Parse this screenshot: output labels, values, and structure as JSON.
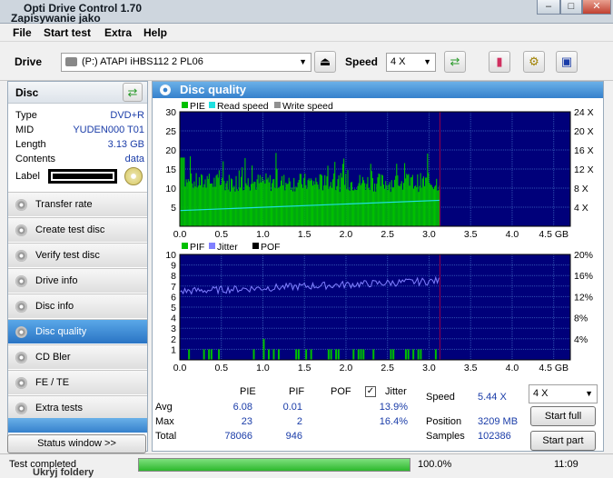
{
  "window": {
    "title": "Opti Drive Control 1.70",
    "behind_title": "Zapisywanie jako",
    "behind_footer": "Ukryj foldery"
  },
  "menu": [
    "File",
    "Start test",
    "Extra",
    "Help"
  ],
  "toolbar": {
    "drive_label": "Drive",
    "drive_value": "(P:)  ATAPI iHBS112  2 PL06",
    "speed_label": "Speed",
    "speed_value": "4 X"
  },
  "disc": {
    "header": "Disc",
    "rows": [
      {
        "label": "Type",
        "value": "DVD+R"
      },
      {
        "label": "MID",
        "value": "YUDEN000 T01"
      },
      {
        "label": "Length",
        "value": "3.13 GB"
      },
      {
        "label": "Contents",
        "value": "data"
      }
    ],
    "label_label": "Label"
  },
  "nav": [
    "Transfer rate",
    "Create test disc",
    "Verify test disc",
    "Drive info",
    "Disc info",
    "Disc quality",
    "CD Bler",
    "FE / TE",
    "Extra tests"
  ],
  "nav_active": 5,
  "status_window": "Status window >>",
  "panel_title": "Disc quality",
  "legend1": [
    "PIE",
    "Read speed",
    "Write speed"
  ],
  "legend2": [
    "PIF",
    "Jitter",
    "POF"
  ],
  "colors": {
    "pie": "#00c000",
    "read": "#20e0e0",
    "write": "#909090",
    "pif": "#00c000",
    "jitter": "#8080ff",
    "pof": "#000000",
    "plot_bg": "#00007a",
    "grid": "#3050b0",
    "marker": "#a00040"
  },
  "chart_data": [
    {
      "type": "area",
      "series": [
        {
          "name": "PIE",
          "stat_max": 23,
          "stat_avg": 6.08
        },
        {
          "name": "Read speed",
          "unit": "X"
        }
      ],
      "x_ticks": [
        "0.0",
        "0.5",
        "1.0",
        "1.5",
        "2.0",
        "2.5",
        "3.0",
        "3.5",
        "4.0",
        "4.5 GB"
      ],
      "y_ticks_left": [
        "30",
        "25",
        "20",
        "15",
        "10",
        "5"
      ],
      "y_ticks_right": [
        "24 X",
        "20 X",
        "16 X",
        "12 X",
        "8 X",
        "4 X"
      ],
      "xlim": [
        0,
        4.7
      ],
      "ylim_left": [
        0,
        30
      ],
      "data_end_gb": 3.13,
      "read_speed": [
        [
          0.0,
          3.3
        ],
        [
          3.13,
          5.44
        ]
      ]
    },
    {
      "type": "bar",
      "series": [
        {
          "name": "PIF",
          "stat_max": 2,
          "stat_avg": 0.01
        },
        {
          "name": "Jitter",
          "unit": "%"
        }
      ],
      "x_ticks": [
        "0.0",
        "0.5",
        "1.0",
        "1.5",
        "2.0",
        "2.5",
        "3.0",
        "3.5",
        "4.0",
        "4.5 GB"
      ],
      "y_ticks_left": [
        "10",
        "9",
        "8",
        "7",
        "6",
        "5",
        "4",
        "3",
        "2",
        "1"
      ],
      "y_ticks_right": [
        "20%",
        "16%",
        "12%",
        "8%",
        "4%"
      ],
      "xlim": [
        0,
        4.7
      ],
      "ylim_left": [
        0,
        10
      ],
      "ylim_right": [
        0,
        20
      ],
      "data_end_gb": 3.13,
      "jitter_pct": [
        [
          0.0,
          13.0
        ],
        [
          3.13,
          15.0
        ]
      ]
    }
  ],
  "stats": {
    "headers": [
      "PIE",
      "PIF",
      "POF",
      "Jitter"
    ],
    "rows": [
      {
        "label": "Avg",
        "pie": "6.08",
        "pif": "0.01",
        "pof": "",
        "jitter": "13.9%"
      },
      {
        "label": "Max",
        "pie": "23",
        "pif": "2",
        "pof": "",
        "jitter": "16.4%"
      },
      {
        "label": "Total",
        "pie": "78066",
        "pif": "946",
        "pof": "",
        "jitter": ""
      }
    ],
    "speed_label": "Speed",
    "speed_value": "5.44 X",
    "position_label": "Position",
    "position_value": "3209 MB",
    "samples_label": "Samples",
    "samples_value": "102386",
    "speed_select": "4 X",
    "start_full": "Start full",
    "start_part": "Start part"
  },
  "statusbar": {
    "text": "Test completed",
    "progress": 1.0,
    "progress_text": "100.0%",
    "time": "11:09"
  }
}
